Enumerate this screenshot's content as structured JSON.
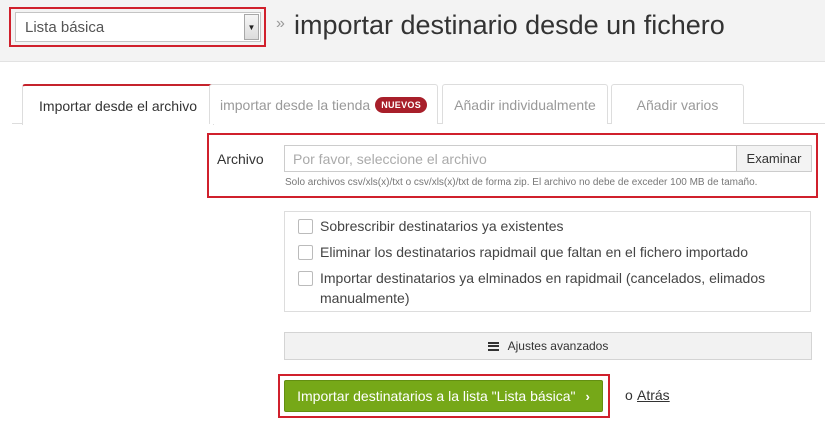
{
  "header": {
    "list_select": {
      "value": "Lista básica"
    },
    "breadcrumb_sep": "»",
    "title": "importar destinario desde un fichero"
  },
  "tabs": [
    {
      "label": "Importar desde el archivo",
      "active": true
    },
    {
      "label": "importar desde la tienda",
      "badge": "NUEVOS",
      "active": false
    },
    {
      "label": "Añadir individualmente",
      "active": false
    },
    {
      "label": "Añadir varios",
      "active": false
    }
  ],
  "file": {
    "label": "Archivo",
    "placeholder": "Por favor, seleccione el archivo",
    "browse_label": "Examinar",
    "help": "Solo archivos csv/xls(x)/txt o csv/xls(x)/txt de forma zip. El archivo no debe de exceder 100 MB de tamaño."
  },
  "options": [
    {
      "label": "Sobrescribir destinatarios ya existentes",
      "checked": false
    },
    {
      "label": "Eliminar los destinatarios rapidmail que faltan en el fichero importado",
      "checked": false
    },
    {
      "label_line1": "Importar destinatarios ya elminados en rapidmail (cancelados, elimados",
      "label_line2": "manualmente)",
      "checked": false
    }
  ],
  "advanced": {
    "label": "Ajustes avanzados"
  },
  "submit": {
    "label": "Importar destinatarios a la lista \"Lista básica\"",
    "chevron": "›"
  },
  "back": {
    "or": "o",
    "label": "Atrás"
  },
  "colors": {
    "highlight": "#d0202c",
    "submit": "#76a818",
    "badge": "#a81f2a"
  }
}
